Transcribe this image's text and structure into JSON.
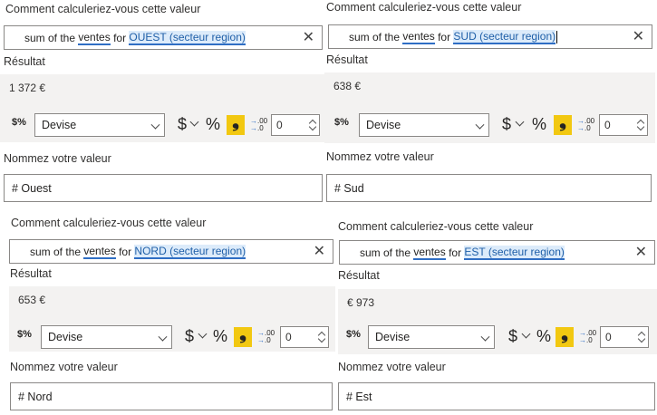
{
  "labels": {
    "how_calc": "Comment calculeriez-vous cette valeur",
    "result": "Résultat",
    "name_value": "Nommez votre valeur"
  },
  "icons": {
    "currency_format": "$%",
    "dollar": "$",
    "percent": "%",
    "comma": "❟",
    "decimals": ".00→.0",
    "close": "✕"
  },
  "panels": [
    {
      "query": {
        "prefix": "sum of the ",
        "field": "ventes",
        "mid": " for ",
        "sector": "OUEST (secteur region)"
      },
      "result": "1 372 €",
      "format": "Devise",
      "decimals": "0",
      "name": "# Ouest"
    },
    {
      "query": {
        "prefix": "sum of the ",
        "field": "ventes",
        "mid": " for ",
        "sector": "SUD (secteur region)"
      },
      "result": "638 €",
      "format": "Devise",
      "decimals": "0",
      "name": "# Sud"
    },
    {
      "query": {
        "prefix": "sum of the ",
        "field": "ventes",
        "mid": " for ",
        "sector": "NORD (secteur region)"
      },
      "result": "653 €",
      "format": "Devise",
      "decimals": "0",
      "name": "# Nord"
    },
    {
      "query": {
        "prefix": "sum of the ",
        "field": "ventes",
        "mid": " for ",
        "sector": "EST (secteur region)"
      },
      "result": "€ 973",
      "format": "Devise",
      "decimals": "0",
      "name": "# Est"
    }
  ]
}
